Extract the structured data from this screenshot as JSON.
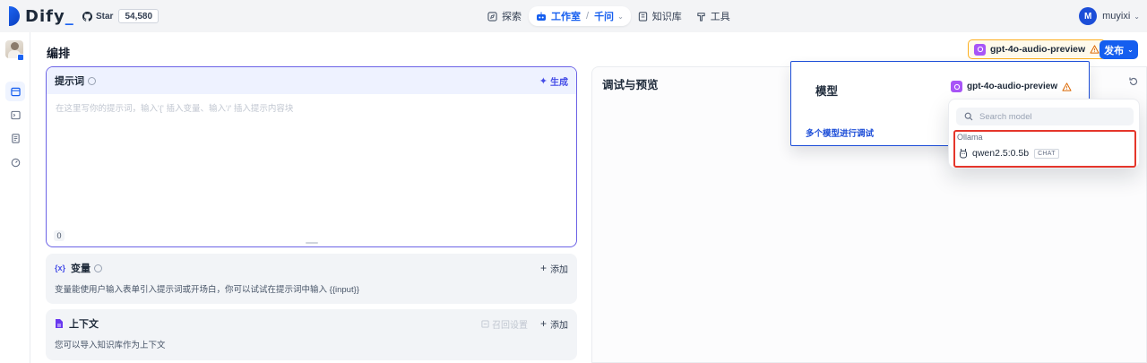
{
  "brand": {
    "name": "Dify"
  },
  "github": {
    "label": "Star",
    "count": "54,580"
  },
  "nav": {
    "explore": "探索",
    "studio": "工作室",
    "studio_app": "千问",
    "knowledge": "知识库",
    "tools": "工具"
  },
  "user": {
    "initial": "M",
    "name": "muyixi"
  },
  "page": {
    "title": "编排"
  },
  "header_model": {
    "name": "gpt-4o-audio-preview"
  },
  "publish": {
    "label": "发布"
  },
  "prompt": {
    "title": "提示词",
    "generate": "生成",
    "placeholder": "在这里写你的提示词，输入'{' 插入变量、输入'/' 插入提示内容块",
    "count": "0"
  },
  "variables": {
    "icon": "{x}",
    "title": "变量",
    "add": "添加",
    "description": "变量能使用户输入表单引入提示词或开场白，你可以试试在提示词中输入 {{input}}"
  },
  "context": {
    "title": "上下文",
    "recall": "召回设置",
    "add": "添加",
    "description": "您可以导入知识库作为上下文"
  },
  "debug": {
    "title": "调试与预览"
  },
  "model_popup": {
    "title": "模型",
    "model": "gpt-4o-audio-preview",
    "multi": "多个模型进行调试"
  },
  "dropdown": {
    "search_placeholder": "Search model",
    "provider": "Ollama",
    "model": "qwen2.5:0.5b",
    "tag": "CHAT"
  },
  "colors": {
    "accent": "#155eef",
    "warning_border": "#fdb022",
    "highlight": "#e5362b",
    "prompt_border": "#6c63e6"
  }
}
